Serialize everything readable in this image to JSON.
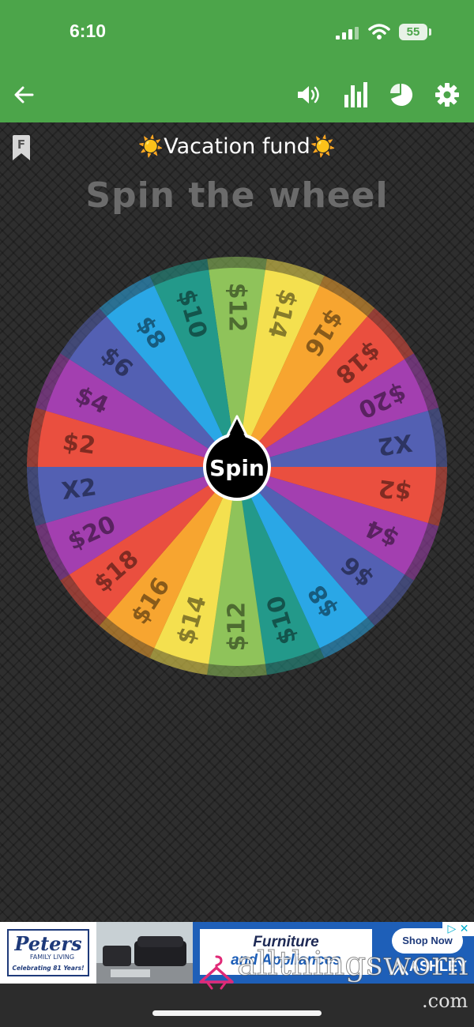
{
  "status": {
    "time": "6:10",
    "battery": "55"
  },
  "toolbar": {
    "back_icon": "arrow-left-icon",
    "sound_icon": "volume-icon",
    "stats_icon": "bar-chart-icon",
    "results_icon": "pie-chart-icon",
    "settings_icon": "gear-icon",
    "color": "#4ca54a"
  },
  "header": {
    "bookmark_letter": "F",
    "sun_left": "☀️",
    "title": "Vacation fund",
    "sun_right": "☀️",
    "subtitle": "Spin the wheel"
  },
  "wheel": {
    "spin_label": "Spin",
    "segments": [
      {
        "label": "$12",
        "color": "#8fc35a"
      },
      {
        "label": "$14",
        "color": "#f4e04f"
      },
      {
        "label": "$16",
        "color": "#f7a530"
      },
      {
        "label": "$18",
        "color": "#ea4f3f"
      },
      {
        "label": "$20",
        "color": "#a33fb0"
      },
      {
        "label": "X2",
        "color": "#5360b3"
      },
      {
        "label": "$2",
        "color": "#ea4f3f"
      },
      {
        "label": "$4",
        "color": "#a33fb0"
      },
      {
        "label": "$6",
        "color": "#5360b3"
      },
      {
        "label": "$8",
        "color": "#2aa7e6"
      },
      {
        "label": "$10",
        "color": "#23998a"
      },
      {
        "label": "$12",
        "color": "#8fc35a"
      },
      {
        "label": "$14",
        "color": "#f4e04f"
      },
      {
        "label": "$16",
        "color": "#f7a530"
      },
      {
        "label": "$18",
        "color": "#ea4f3f"
      },
      {
        "label": "$20",
        "color": "#a33fb0"
      },
      {
        "label": "X2",
        "color": "#5360b3"
      },
      {
        "label": "$2",
        "color": "#ea4f3f"
      },
      {
        "label": "$4",
        "color": "#a33fb0"
      },
      {
        "label": "$6",
        "color": "#5360b3"
      },
      {
        "label": "$8",
        "color": "#2aa7e6"
      },
      {
        "label": "$10",
        "color": "#23998a"
      }
    ]
  },
  "ad": {
    "brand": "Peters",
    "brand_sub": "FAMILY LIVING",
    "brand_tag": "Celebrating 81 Years!",
    "headline_1": "Furniture",
    "headline_2": "and Appliances",
    "cta": "Shop Now",
    "advertiser": "ASHLEY"
  },
  "watermark": {
    "site": "allthingsworn",
    "tld": ".com"
  }
}
